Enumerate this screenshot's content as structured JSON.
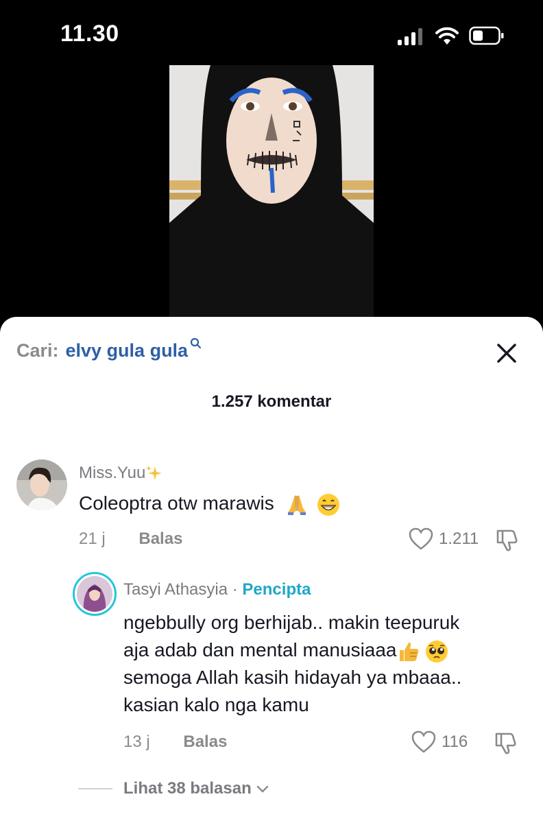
{
  "status_bar": {
    "time": "11.30",
    "signal_bars": 3,
    "signal_max": 4
  },
  "search": {
    "prefix": "Cari:",
    "query": "elvy gula gula"
  },
  "comments_header": {
    "count_label": "1.257 komentar"
  },
  "comments": [
    {
      "username": "Miss.Yuu",
      "text": "Coleoptra otw marawis",
      "emojis": [
        "folded-hands",
        "grinning-face"
      ],
      "age": "21 j",
      "reply_label": "Balas",
      "likes": "1.211"
    }
  ],
  "reply": {
    "username": "Tasyi Athasyia",
    "separator": " · ",
    "creator_label": "Pencipta",
    "text_lines": [
      "ngebbully org berhijab.. makin teepuruk",
      "aja adab dan mental manusiaaa",
      "semoga Allah kasih hidayah ya mbaaa..",
      "kasian kalo nga kamu"
    ],
    "age": "13 j",
    "reply_label": "Balas",
    "likes": "116"
  },
  "view_replies": {
    "label": "Lihat 38 balasan"
  },
  "colors": {
    "link_blue": "#2e5fa6",
    "creator_teal": "#1fa7c7",
    "text_dark": "#161823",
    "muted": "#8a8a8a"
  }
}
